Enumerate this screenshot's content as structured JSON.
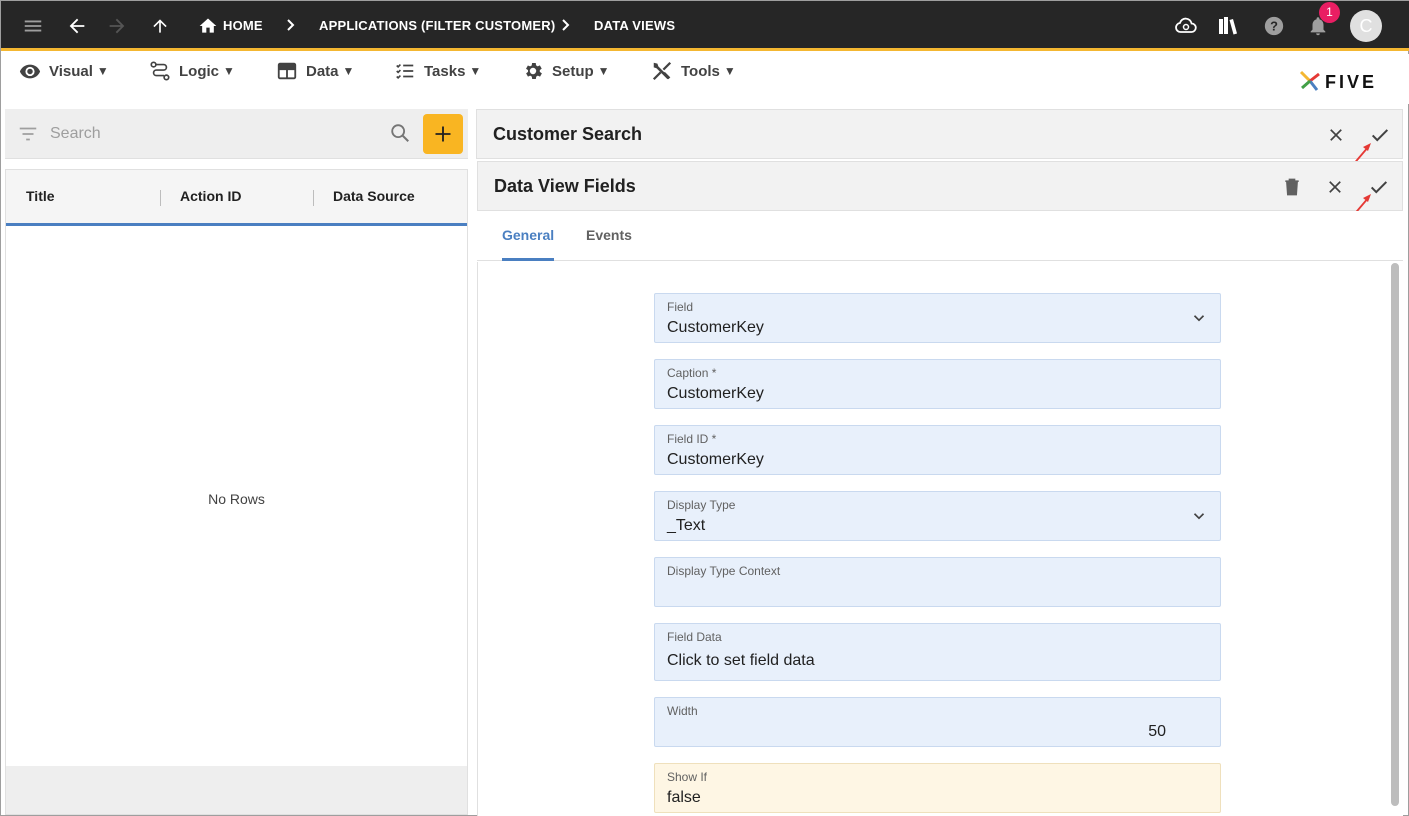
{
  "appbar": {
    "breadcrumbs": [
      {
        "label": "HOME"
      },
      {
        "label": "APPLICATIONS (FILTER CUSTOMER)"
      },
      {
        "label": "DATA VIEWS"
      }
    ],
    "notification_count": "1",
    "avatar_initial": "C"
  },
  "menu": {
    "items": [
      {
        "label": "Visual",
        "icon": "eye-icon"
      },
      {
        "label": "Logic",
        "icon": "logic-icon"
      },
      {
        "label": "Data",
        "icon": "table-icon"
      },
      {
        "label": "Tasks",
        "icon": "tasks-icon"
      },
      {
        "label": "Setup",
        "icon": "gear-icon"
      },
      {
        "label": "Tools",
        "icon": "tools-icon"
      }
    ],
    "caret": "▼",
    "logo_text": "FIVE"
  },
  "list": {
    "search_placeholder": "Search",
    "columns": [
      "Title",
      "Action ID",
      "Data Source"
    ],
    "empty_text": "No Rows"
  },
  "customer_search": {
    "title": "Customer Search"
  },
  "fields_panel": {
    "title": "Data View Fields",
    "tabs": [
      {
        "label": "General",
        "active": true
      },
      {
        "label": "Events",
        "active": false
      }
    ]
  },
  "form": {
    "field": {
      "label": "Field",
      "value": "CustomerKey"
    },
    "caption": {
      "label": "Caption *",
      "value": "CustomerKey"
    },
    "field_id": {
      "label": "Field ID *",
      "value": "CustomerKey"
    },
    "display_type": {
      "label": "Display Type",
      "value": "_Text"
    },
    "display_type_context": {
      "label": "Display Type Context",
      "value": ""
    },
    "field_data": {
      "label": "Field Data",
      "value": "Click to set field data"
    },
    "width": {
      "label": "Width",
      "value": "50"
    },
    "show_if": {
      "label": "Show If",
      "value": "false"
    }
  },
  "colors": {
    "appbar_bg": "#262626",
    "accent": "#f4b731",
    "primary": "#4a7fc1",
    "badge": "#e91e63",
    "field_bg": "#e8f0fb",
    "warn_field_bg": "#fef6e4",
    "annotation_arrow": "#e53935"
  }
}
